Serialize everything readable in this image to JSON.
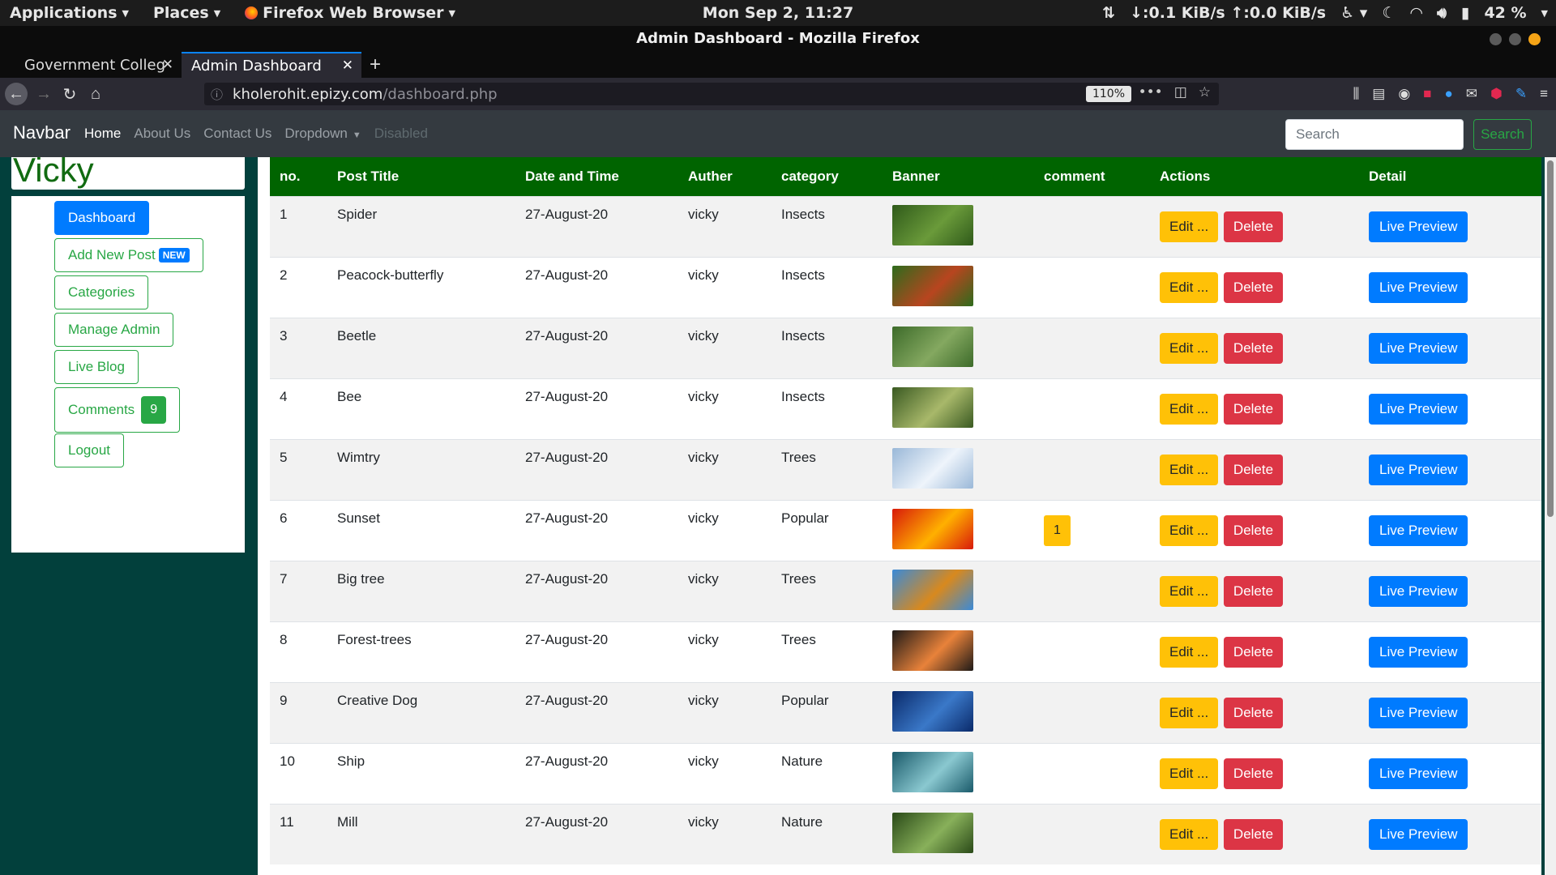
{
  "system_bar": {
    "applications": "Applications",
    "places": "Places",
    "browser_menu": "Firefox Web Browser",
    "clock": "Mon Sep  2, 11:27",
    "network": "↓:0.1 KiB/s ↑:0.0 KiB/s",
    "battery": "42 %"
  },
  "window": {
    "title": "Admin Dashboard - Mozilla Firefox"
  },
  "tabs": [
    {
      "label": "Government Colleg"
    },
    {
      "label": "Admin Dashboard"
    }
  ],
  "urlbar": {
    "host": "kholerohit.epizy.com",
    "path": "/dashboard.php",
    "zoom": "110%"
  },
  "site_nav": {
    "brand": "Navbar",
    "links": [
      "Home",
      "About Us",
      "Contact Us",
      "Dropdown",
      "Disabled"
    ],
    "search_placeholder": "Search",
    "search_button": "Search"
  },
  "sidebar": {
    "user": "Vicky",
    "dashboard": "Dashboard",
    "add_new_post": "Add New Post",
    "new_badge": "NEW",
    "categories": "Categories",
    "manage_admin": "Manage Admin",
    "live_blog": "Live Blog",
    "comments": "Comments",
    "comments_count": "9",
    "logout": "Logout"
  },
  "table": {
    "headers": [
      "no.",
      "Post Title",
      "Date and Time",
      "Auther",
      "category",
      "Banner",
      "comment",
      "Actions",
      "Detail"
    ],
    "edit_label": "Edit ...",
    "delete_label": "Delete",
    "preview_label": "Live Preview",
    "rows": [
      {
        "no": "1",
        "title": "Spider",
        "date": "27-August-20",
        "author": "vicky",
        "category": "Insects",
        "comment": "",
        "banner_colors": [
          "#2f5a1a",
          "#6a9a3a"
        ]
      },
      {
        "no": "2",
        "title": "Peacock-butterfly",
        "date": "27-August-20",
        "author": "vicky",
        "category": "Insects",
        "comment": "",
        "banner_colors": [
          "#2e6b1c",
          "#b8451f"
        ]
      },
      {
        "no": "3",
        "title": "Beetle",
        "date": "27-August-20",
        "author": "vicky",
        "category": "Insects",
        "comment": "",
        "banner_colors": [
          "#3d6b2a",
          "#84a860"
        ]
      },
      {
        "no": "4",
        "title": "Bee",
        "date": "27-August-20",
        "author": "vicky",
        "category": "Insects",
        "comment": "",
        "banner_colors": [
          "#3a5a22",
          "#a8b86a"
        ]
      },
      {
        "no": "5",
        "title": "Wimtry",
        "date": "27-August-20",
        "author": "vicky",
        "category": "Trees",
        "comment": "",
        "banner_colors": [
          "#9ab8d8",
          "#eef4fb"
        ]
      },
      {
        "no": "6",
        "title": "Sunset",
        "date": "27-August-20",
        "author": "vicky",
        "category": "Popular",
        "comment": "1",
        "banner_colors": [
          "#d81a0a",
          "#ffb000"
        ]
      },
      {
        "no": "7",
        "title": "Big tree",
        "date": "27-August-20",
        "author": "vicky",
        "category": "Trees",
        "comment": "",
        "banner_colors": [
          "#3a8ad8",
          "#d8891e"
        ]
      },
      {
        "no": "8",
        "title": "Forest-trees",
        "date": "27-August-20",
        "author": "vicky",
        "category": "Trees",
        "comment": "",
        "banner_colors": [
          "#1e1a18",
          "#e8823a"
        ]
      },
      {
        "no": "9",
        "title": "Creative Dog",
        "date": "27-August-20",
        "author": "vicky",
        "category": "Popular",
        "comment": "",
        "banner_colors": [
          "#0a2a6a",
          "#3a78c8"
        ]
      },
      {
        "no": "10",
        "title": "Ship",
        "date": "27-August-20",
        "author": "vicky",
        "category": "Nature",
        "comment": "",
        "banner_colors": [
          "#1a5a6a",
          "#8ac8d0"
        ]
      },
      {
        "no": "11",
        "title": "Mill",
        "date": "27-August-20",
        "author": "vicky",
        "category": "Nature",
        "comment": "",
        "banner_colors": [
          "#2a4a18",
          "#88b05a"
        ]
      }
    ]
  },
  "colors": {
    "page_bg": "#02403c",
    "table_header": "#006400",
    "primary": "#007bff",
    "success": "#28a745",
    "warning": "#ffc107",
    "danger": "#dc3545",
    "navbar_bg": "#343a40"
  }
}
